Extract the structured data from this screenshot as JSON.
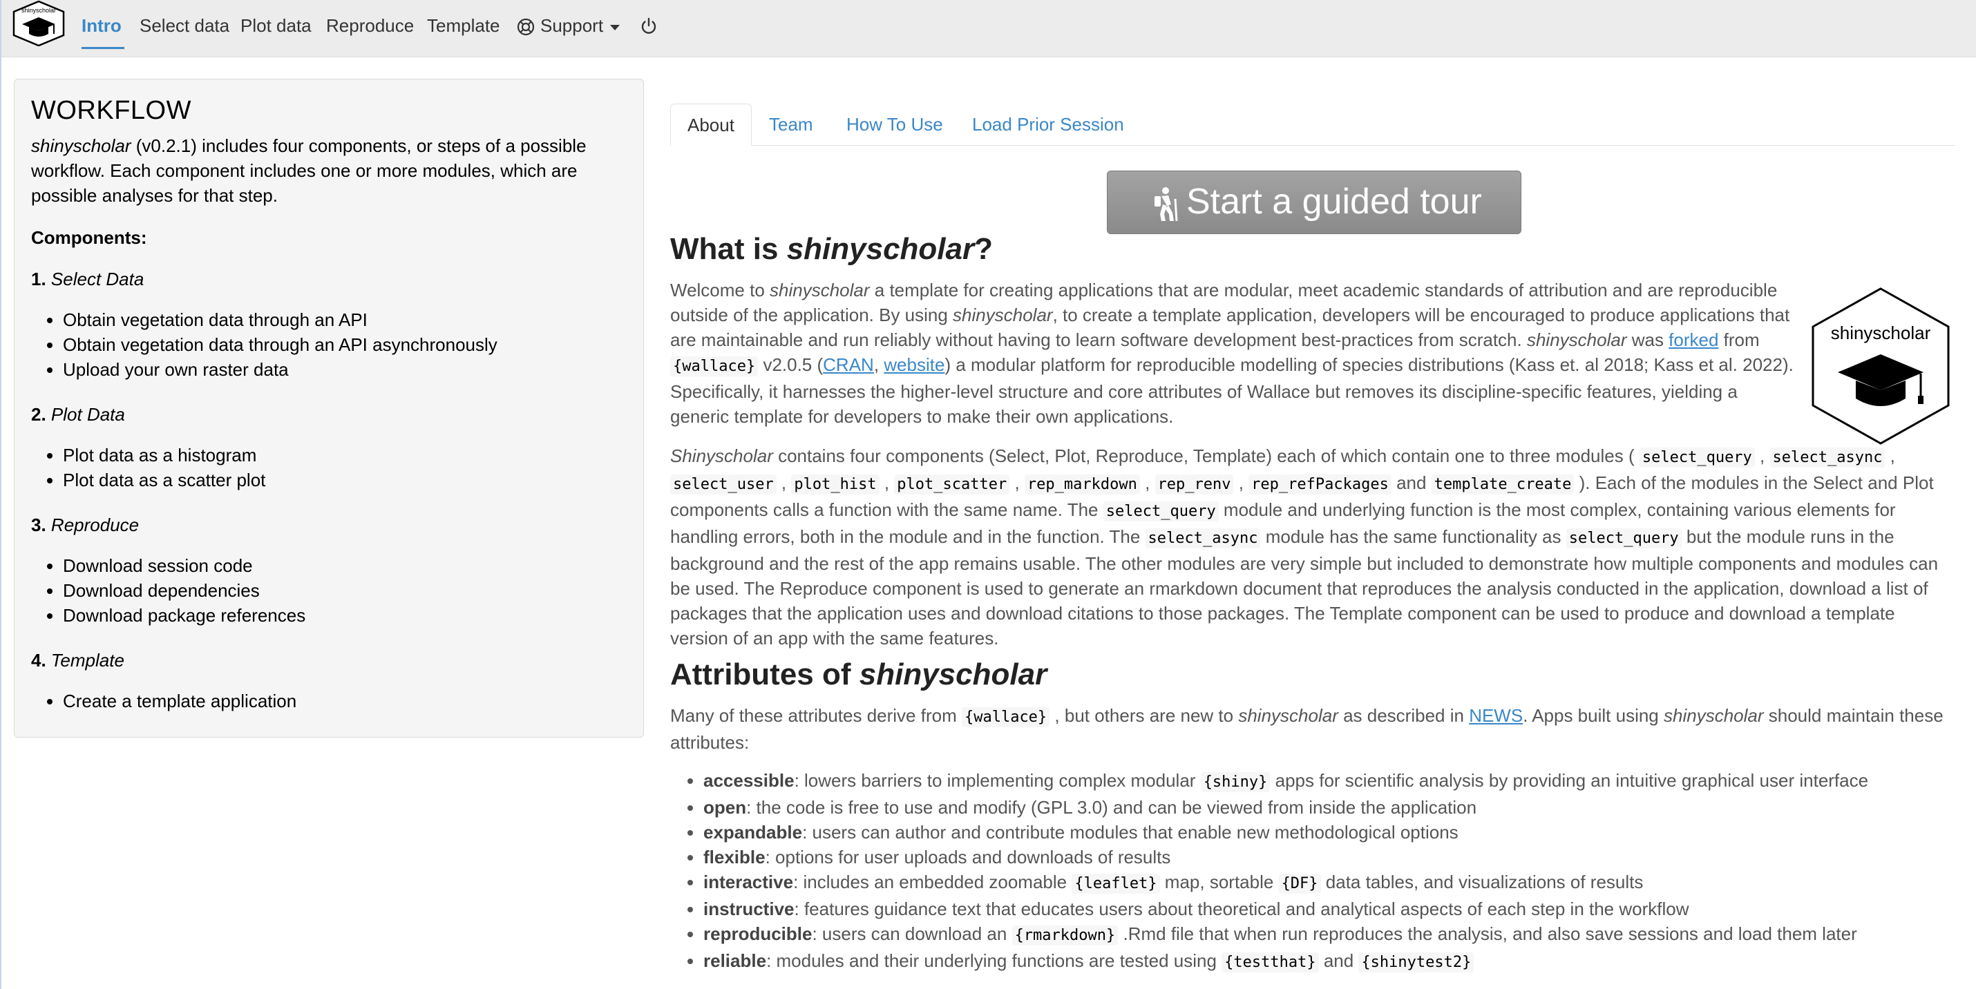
{
  "navbar": {
    "logo_text": "shinyscholar",
    "items": [
      {
        "label": "Intro",
        "active": true
      },
      {
        "label": "Select data"
      },
      {
        "label": "Plot data"
      },
      {
        "label": "Reproduce"
      },
      {
        "label": "Template"
      }
    ],
    "support_label": "Support",
    "icons": {
      "support": "life-ring-icon",
      "power": "power-icon"
    },
    "accent_color": "#3a87c9"
  },
  "workflow": {
    "title": "WORKFLOW",
    "intro_italic": "shinyscholar",
    "intro_rest": " (v0.2.1) includes four components, or steps of a possible workflow. Each component includes one or more modules, which are possible analyses for that step.",
    "components_heading": "Components:",
    "steps": [
      {
        "num": "1.",
        "name": "Select Data",
        "items": [
          "Obtain vegetation data through an API",
          "Obtain vegetation data through an API asynchronously",
          "Upload your own raster data"
        ]
      },
      {
        "num": "2.",
        "name": "Plot Data",
        "items": [
          "Plot data as a histogram",
          "Plot data as a scatter plot"
        ]
      },
      {
        "num": "3.",
        "name": "Reproduce",
        "items": [
          "Download session code",
          "Download dependencies",
          "Download package references"
        ]
      },
      {
        "num": "4.",
        "name": "Template",
        "items": [
          "Create a template application"
        ]
      }
    ]
  },
  "tabs": [
    {
      "label": "About",
      "active": true
    },
    {
      "label": "Team"
    },
    {
      "label": "How To Use"
    },
    {
      "label": "Load Prior Session"
    }
  ],
  "tour_button": {
    "label": "Start a guided tour",
    "icon": "hiking-icon"
  },
  "about": {
    "h_what_prefix": "What is ",
    "h_what_italic": "shinyscholar",
    "h_what_suffix": "?",
    "p1": {
      "t1": "Welcome to ",
      "i1": "shinyscholar",
      "t2": " a template for creating applications that are modular, meet academic standards of attribution and are reproducible outside of the application. By using ",
      "i2": "shinyscholar",
      "t3": ", to create a template application, developers will be encouraged to produce applications that are maintainable and run reliably without having to learn software development best-practices from scratch. ",
      "i3": "shinyscholar",
      "t4": " was ",
      "link_forked": "forked",
      "t5": " from ",
      "code_wallace": "{wallace}",
      "t6": " v2.0.5 (",
      "link_cran": "CRAN",
      "t7": ", ",
      "link_website": "website",
      "t8": ") a modular platform for reproducible modelling of species distributions (Kass et. al 2018; Kass et al. 2022). Specifically, it harnesses the higher-level structure and core attributes of Wallace but removes its discipline-specific features, yielding a generic template for developers to make their own applications."
    },
    "p2": {
      "i1": "Shinyscholar",
      "t1": " contains four components (Select, Plot, Reproduce, Template) each of which contain one to three modules ( ",
      "c1": "select_query",
      "t2": " ,",
      "c2": "select_async",
      "t3": " , ",
      "c3": "select_user",
      "t4": " , ",
      "c4": "plot_hist",
      "t5": " , ",
      "c5": "plot_scatter",
      "t6": " , ",
      "c6": "rep_markdown",
      "t7": " , ",
      "c7": "rep_renv",
      "t8": " , ",
      "c8": "rep_refPackages",
      "t9": " and ",
      "c9": "template_create",
      "t10": " ). Each of the modules in the Select and Plot components calls a function with the same name. The ",
      "c10": "select_query",
      "t11": " module and underlying function is the most complex, containing various elements for handling errors, both in the module and in the function. The ",
      "c11": "select_async",
      "t12": " module has the same functionality as ",
      "c12": "select_query",
      "t13": " but the module runs in the background and the rest of the app remains usable. The other modules are very simple but included to demonstrate how multiple components and modules can be used. The Reproduce component is used to generate an rmarkdown document that reproduces the analysis conducted in the application, download a list of packages that the application uses and download citations to those packages. The Template component can be used to produce and download a template version of an app with the same features."
    },
    "h_attr_prefix": "Attributes of ",
    "h_attr_italic": "shinyscholar",
    "p3": {
      "t1": "Many of these attributes derive from ",
      "c1": "{wallace}",
      "t2": " , but others are new to ",
      "i1": "shinyscholar",
      "t3": " as described in ",
      "link_news": "NEWS",
      "t4": ". Apps built using ",
      "i2": "shinyscholar",
      "t5": " should maintain these attributes:"
    },
    "attributes": [
      {
        "name": "accessible",
        "pre": ": lowers barriers to implementing complex modular ",
        "code": "{shiny}",
        "post": " apps for scientific analysis by providing an intuitive graphical user interface"
      },
      {
        "name": "open",
        "pre": ": the code is free to use and modify (GPL 3.0) and can be viewed from inside the application"
      },
      {
        "name": "expandable",
        "pre": ": users can author and contribute modules that enable new methodological options"
      },
      {
        "name": "flexible",
        "pre": ": options for user uploads and downloads of results"
      },
      {
        "name": "interactive",
        "pre": ": includes an embedded zoomable ",
        "code": "{leaflet}",
        "mid": " map, sortable ",
        "code2": "{DF}",
        "post": " data tables, and visualizations of results"
      },
      {
        "name": "instructive",
        "pre": ": features guidance text that educates users about theoretical and analytical aspects of each step in the workflow"
      },
      {
        "name": "reproducible",
        "pre": ": users can download an ",
        "code": "{rmarkdown}",
        "post": " .Rmd file that when run reproduces the analysis, and also save sessions and load them later"
      },
      {
        "name": "reliable",
        "pre": ": modules and their underlying functions are tested using ",
        "code": "{testthat}",
        "mid": " and ",
        "code2": "{shinytest2}"
      }
    ],
    "hex_logo_text": "shinyscholar"
  }
}
